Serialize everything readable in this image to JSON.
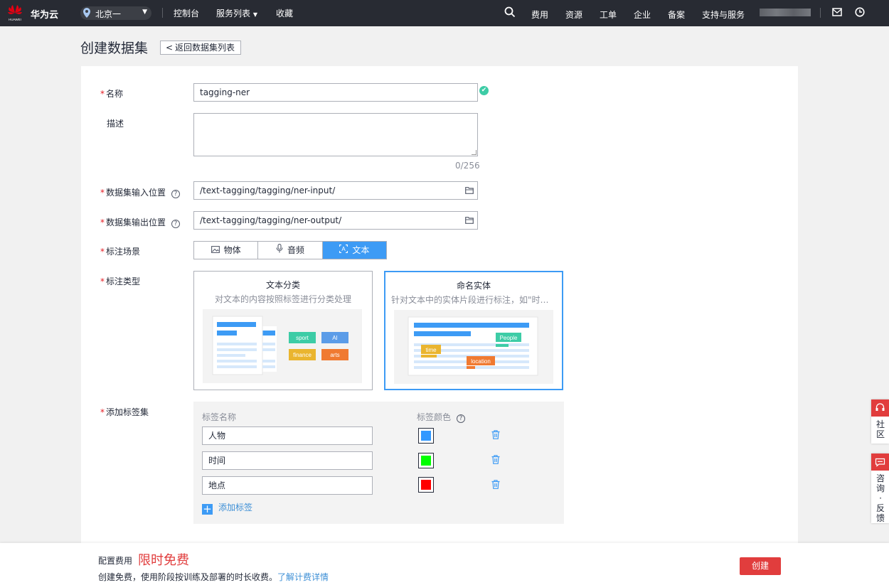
{
  "topnav": {
    "brand": "华为云",
    "logo_text": "HUAWEI",
    "region": "北京一",
    "links": {
      "console": "控制台",
      "services": "服务列表",
      "favorites": "收藏",
      "fees": "费用",
      "resources": "资源",
      "tickets": "工单",
      "enterprise": "企业",
      "filing": "备案",
      "support": "支持与服务"
    }
  },
  "header": {
    "title": "创建数据集",
    "back_label": "返回数据集列表"
  },
  "form": {
    "name": {
      "label": "名称",
      "value": "tagging-ner"
    },
    "description": {
      "label": "描述",
      "value": "",
      "counter": "0/256"
    },
    "input_location": {
      "label": "数据集输入位置",
      "value": "/text-tagging/tagging/ner-input/"
    },
    "output_location": {
      "label": "数据集输出位置",
      "value": "/text-tagging/tagging/ner-output/"
    },
    "scene": {
      "label": "标注场景",
      "options": [
        "物体",
        "音频",
        "文本"
      ],
      "selected": "文本"
    },
    "annotation_type": {
      "label": "标注类型",
      "cards": [
        {
          "title": "文本分类",
          "desc": "对文本的内容按照标签进行分类处理",
          "tags": [
            "sport",
            "AI",
            "finance",
            "arts"
          ],
          "selected": false
        },
        {
          "title": "命名实体",
          "desc": "针对文本中的实体片段进行标注，如\"时间\"、\"地点\"等",
          "tags": [
            "People",
            "time",
            "location"
          ],
          "selected": true
        }
      ]
    },
    "tag_set": {
      "label": "添加标签集",
      "col_name": "标签名称",
      "col_color": "标签颜色",
      "tags": [
        {
          "name": "人物",
          "color": "#3399ff"
        },
        {
          "name": "时间",
          "color": "#00ff00"
        },
        {
          "name": "地点",
          "color": "#ff0000"
        }
      ],
      "add_label": "添加标签"
    }
  },
  "side": {
    "community": "社区",
    "feedback": "咨询·反馈"
  },
  "footer": {
    "fee_label": "配置费用",
    "fee_value": "限时免费",
    "note": "创建免费，使用阶段按训练及部署的时长收费。",
    "link": "了解计费详情",
    "create_label": "创建"
  },
  "colors": {
    "accent": "#3d9bf5",
    "danger": "#e13d3d",
    "nav_bg": "#282b33"
  }
}
